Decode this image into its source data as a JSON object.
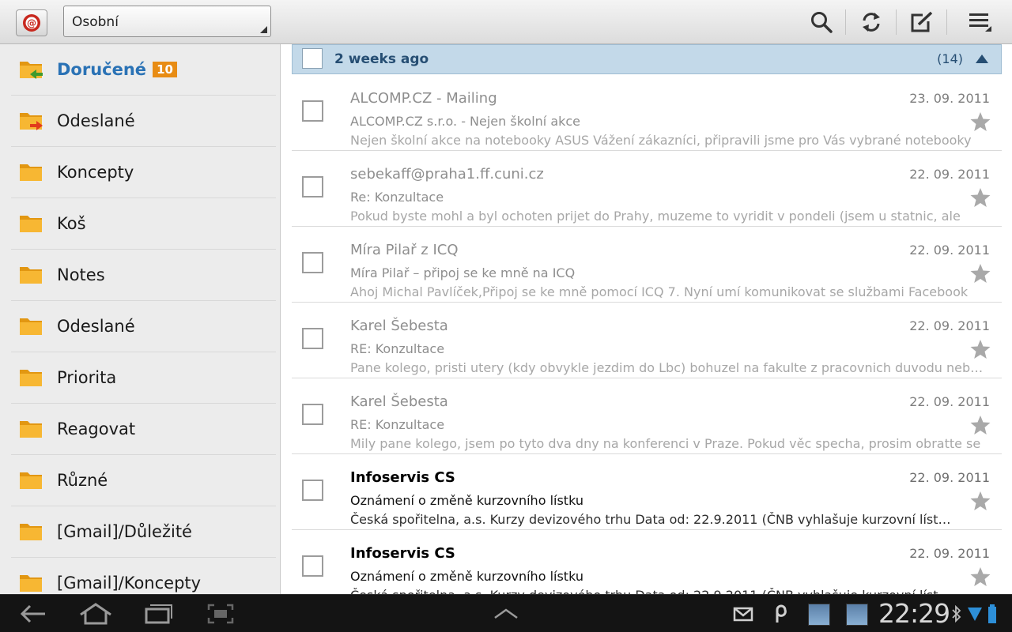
{
  "account": {
    "selected": "Osobní"
  },
  "sidebar": {
    "items": [
      {
        "label": "Doručené",
        "badge": "10",
        "icon": "inbox-folder-icon",
        "selected": true
      },
      {
        "label": "Odeslané",
        "icon": "outbox-folder-icon"
      },
      {
        "label": "Koncepty",
        "icon": "folder-icon"
      },
      {
        "label": "Koš",
        "icon": "folder-icon"
      },
      {
        "label": "Notes",
        "icon": "folder-icon"
      },
      {
        "label": "Odeslané",
        "icon": "folder-icon"
      },
      {
        "label": "Priorita",
        "icon": "folder-icon"
      },
      {
        "label": "Reagovat",
        "icon": "folder-icon"
      },
      {
        "label": "Různé",
        "icon": "folder-icon"
      },
      {
        "label": "[Gmail]/Důležité",
        "icon": "folder-icon"
      },
      {
        "label": "[Gmail]/Koncepty",
        "icon": "folder-icon"
      }
    ]
  },
  "group": {
    "title": "2 weeks ago",
    "count": "(14)"
  },
  "messages": [
    {
      "from": "ALCOMP.CZ - Mailing",
      "date": "23. 09. 2011",
      "subject": "ALCOMP.CZ s.r.o. -  Nejen školní akce",
      "snippet": "Nejen školní akce na notebooky ASUS Vážení zákazníci, připravili jsme pro Vás vybrané notebooky",
      "unread": false
    },
    {
      "from": "sebekaff@praha1.ff.cuni.cz",
      "date": "22. 09. 2011",
      "subject": "Re: Konzultace",
      "snippet": "Pokud byste mohl a byl ochoten prijet do Prahy, muzeme to vyridit v pondeli (jsem u statnic, ale",
      "unread": false
    },
    {
      "from": "Míra Pilař z ICQ",
      "date": "22. 09. 2011",
      "subject": "Míra Pilař – připoj se ke mně na ICQ",
      "snippet": "Ahoj Michal Pavlíček,Připoj se ke mně pomocí ICQ 7. Nyní umí komunikovat se službami Facebook",
      "unread": false
    },
    {
      "from": "Karel Šebesta",
      "date": "22. 09. 2011",
      "subject": "RE: Konzultace",
      "snippet": "Pane kolego, pristi utery (kdy obvykle jezdim do Lbc) bohuzel na fakulte z pracovnich duvodu nebudu",
      "unread": false
    },
    {
      "from": "Karel Šebesta",
      "date": "22. 09. 2011",
      "subject": "RE: Konzultace",
      "snippet": "Mily pane kolego, jsem po tyto dva dny na konferenci v Praze. Pokud věc specha, prosim obratte se",
      "unread": false
    },
    {
      "from": "Infoservis CS",
      "date": "22. 09. 2011",
      "subject": "Oznámení o změně kurzovního lístku",
      "snippet": "Česká spořitelna, a.s. Kurzy devizového trhu Data od: 22.9.2011 (ČNB vyhlašuje kurzovní lístek",
      "unread": true
    },
    {
      "from": "Infoservis CS",
      "date": "22. 09. 2011",
      "subject": "Oznámení o změně kurzovního lístku",
      "snippet": "Česká spořitelna, a.s. Kurzy devizového trhu Data od: 22.9.2011 (ČNB vyhlašuje kurzovní lístek",
      "unread": true
    }
  ],
  "statusbar": {
    "clock": "22:29"
  },
  "colors": {
    "accent": "#2a72b5",
    "badge": "#e88c14",
    "group_header": "#c3d9e9",
    "sysbar": "#141414"
  }
}
